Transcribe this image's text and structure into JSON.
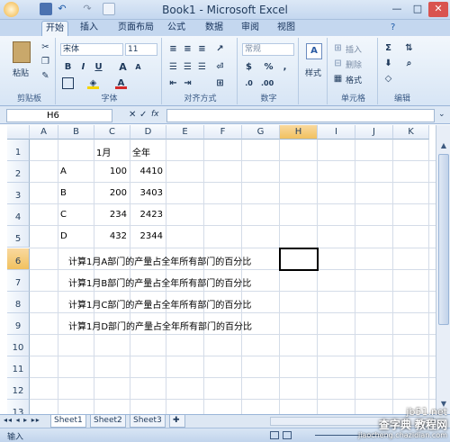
{
  "window": {
    "title": "Book1 - Microsoft Excel",
    "minimize": "—",
    "maximize": "□",
    "close": "✕"
  },
  "tabs": [
    "开始",
    "插入",
    "页面布局",
    "公式",
    "数据",
    "审阅",
    "视图"
  ],
  "ribbon": {
    "clipboard": {
      "label": "剪贴板",
      "paste": "粘贴"
    },
    "font": {
      "label": "字体",
      "name": "宋体",
      "size": "11",
      "bold": "B",
      "italic": "I",
      "underline": "U",
      "grow": "A",
      "shrink": "A"
    },
    "alignment": {
      "label": "对齐方式"
    },
    "number": {
      "label": "数字",
      "format": "常规",
      "percent": "%",
      "comma": ","
    },
    "styles": {
      "label": "样式"
    },
    "cells": {
      "label": "单元格",
      "insert": "插入",
      "delete": "删除",
      "format": "格式"
    },
    "editing": {
      "label": "编辑",
      "sum": "Σ"
    }
  },
  "formula_bar": {
    "name_box": "H6",
    "fx": "fx",
    "content": ""
  },
  "columns": [
    "A",
    "B",
    "C",
    "D",
    "E",
    "F",
    "G",
    "H",
    "I",
    "J",
    "K"
  ],
  "rows": [
    "1",
    "2",
    "3",
    "4",
    "5",
    "6",
    "7",
    "8",
    "9",
    "10",
    "11",
    "12",
    "13"
  ],
  "cells": {
    "C1": "1月",
    "D1": "全年",
    "B2": "A",
    "C2": "100",
    "D2": "4410",
    "B3": "B",
    "C3": "200",
    "D3": "3403",
    "B4": "C",
    "C4": "234",
    "D4": "2423",
    "B5": "D",
    "C5": "432",
    "D5": "2344",
    "B6": "计算1月A部门的产量占全年所有部门的百分比",
    "B7": "计算1月B部门的产量占全年所有部门的百分比",
    "B8": "计算1月C部门的产量占全年所有部门的百分比",
    "B9": "计算1月D部门的产量占全年所有部门的百分比"
  },
  "sheets": [
    "Sheet1",
    "Sheet2",
    "Sheet3"
  ],
  "status": {
    "mode": "输入"
  },
  "watermark": {
    "line1": "查字典 教程网",
    "line2": "jiaocheng.chazidian.com",
    "site": "jb51.net"
  }
}
